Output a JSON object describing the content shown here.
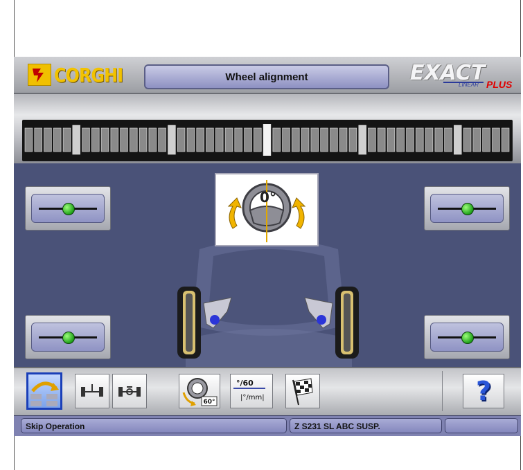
{
  "header": {
    "logo_text": "CORGHI",
    "title": "Wheel alignment",
    "brand_name": "EXACT",
    "brand_sub": "LINEAR",
    "brand_plus": "PLUS"
  },
  "steering": {
    "angle_label": "0°",
    "icon": "steering-wheel-icon"
  },
  "indicators": {
    "front_left": {
      "level": 0.5,
      "status_color": "#22b322"
    },
    "front_right": {
      "level": 0.5,
      "status_color": "#22b322"
    },
    "rear_left": {
      "level": 0.5,
      "status_color": "#22b322"
    },
    "rear_right": {
      "level": 0.5,
      "status_color": "#22b322"
    }
  },
  "toolbar": {
    "buttons": [
      {
        "icon": "skip-operation-icon",
        "active": true
      },
      {
        "icon": "axle-front-icon",
        "active": false
      },
      {
        "icon": "axle-rear-icon",
        "active": false
      },
      {
        "icon": "steering-turn-icon",
        "label": "60°",
        "active": false
      },
      {
        "icon": "ratio-icon",
        "label_top": "°/60",
        "label_bottom": "|°/mm|",
        "active": false
      },
      {
        "icon": "checkered-flag-icon",
        "active": false
      }
    ],
    "help_label": "?"
  },
  "status": {
    "left": "Skip Operation",
    "center": "Z S231 SL ABC SUSP.",
    "right": ""
  },
  "colors": {
    "accent_blue": "#1a3fb8",
    "logo_yellow": "#f2c200",
    "plus_red": "#e00000",
    "background": "#4a5278"
  }
}
